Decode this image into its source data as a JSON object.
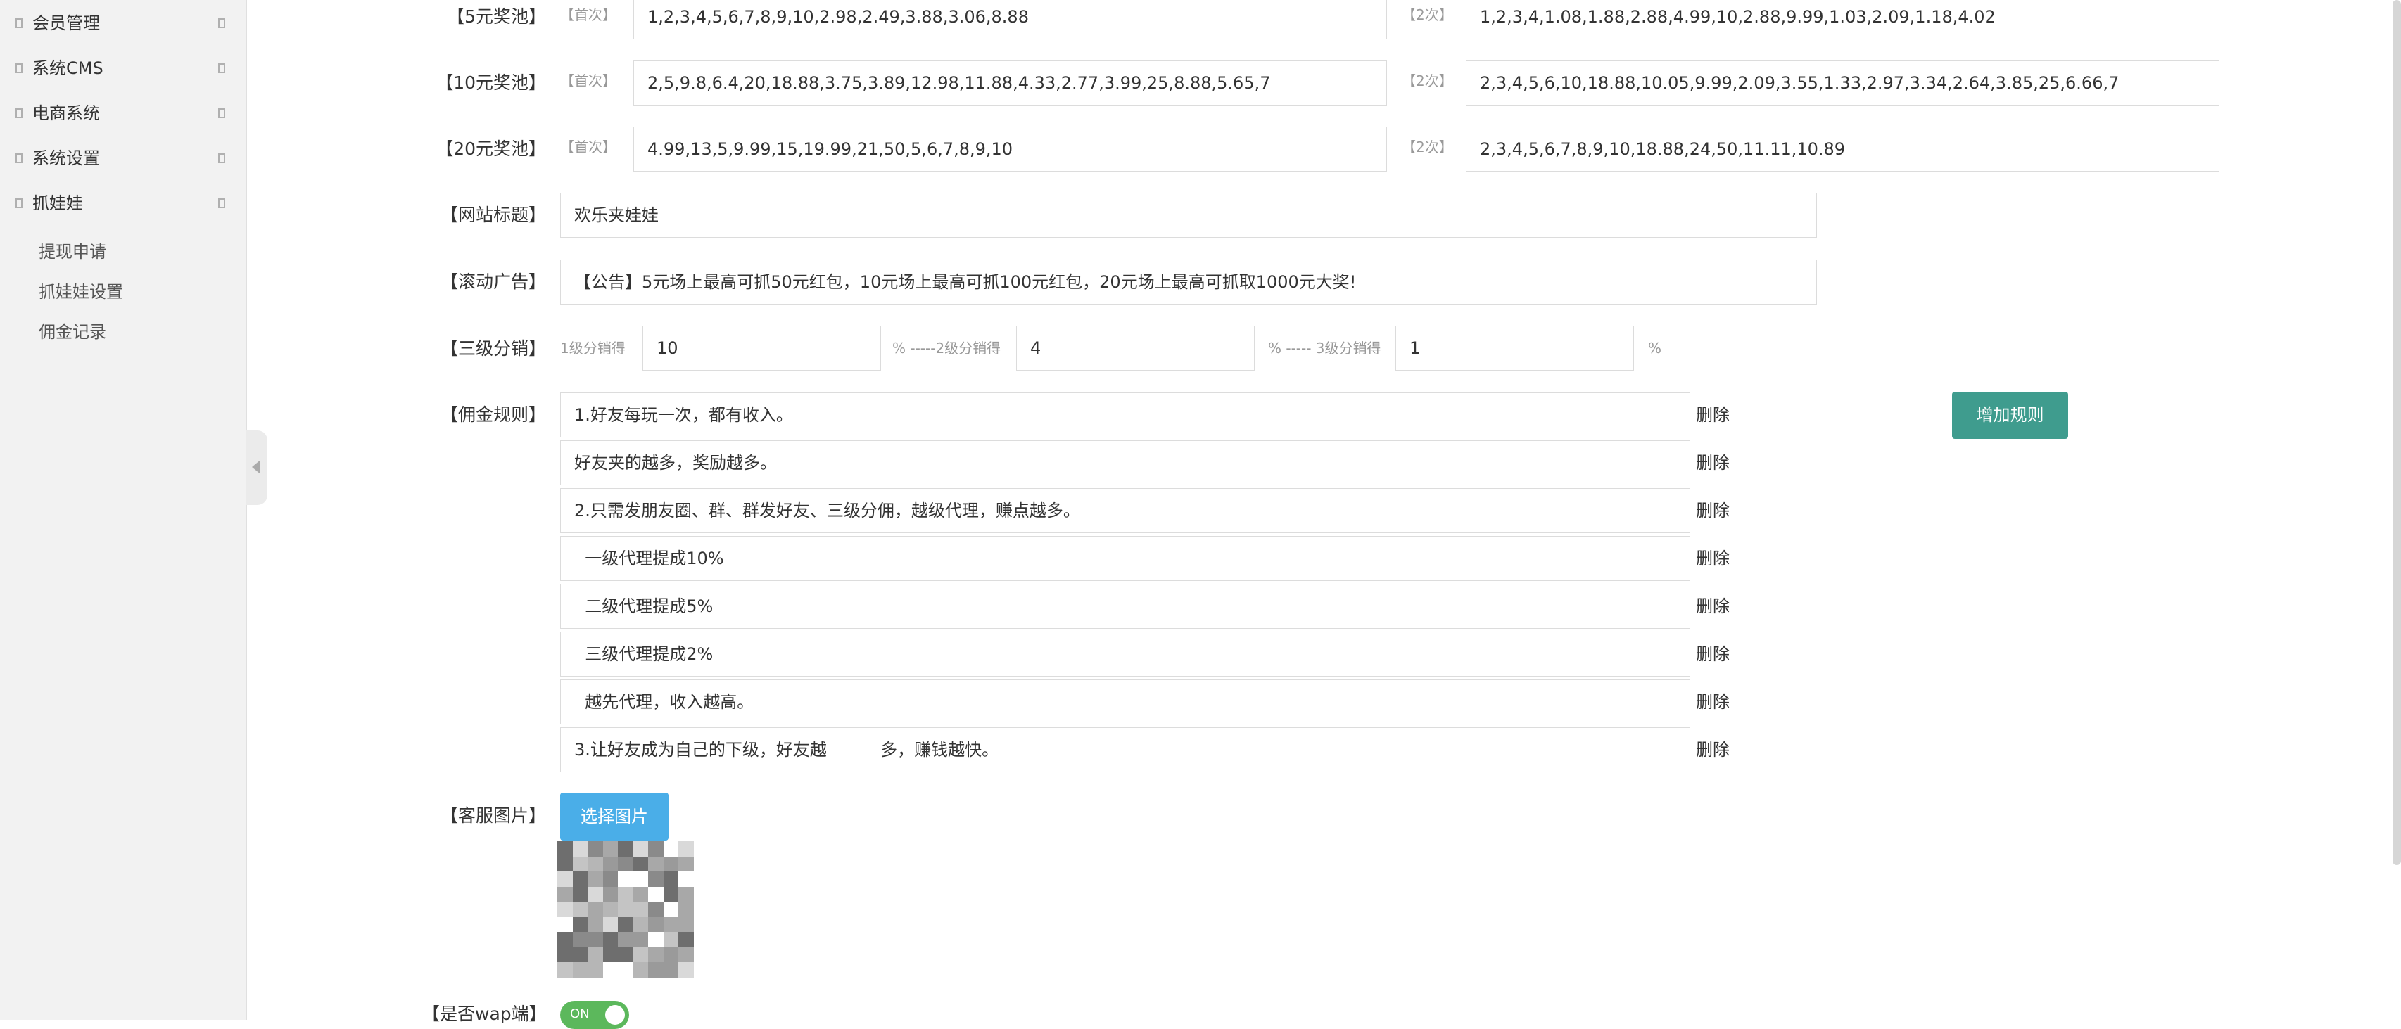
{
  "sidebar": {
    "menu": [
      {
        "label": "会员管理"
      },
      {
        "label": "系统CMS"
      },
      {
        "label": "电商系统"
      },
      {
        "label": "系统设置"
      },
      {
        "label": "抓娃娃"
      }
    ],
    "submenu": [
      {
        "label": "提现申请"
      },
      {
        "label": "抓娃娃设置"
      },
      {
        "label": "佣金记录"
      }
    ]
  },
  "form": {
    "pools": [
      {
        "label": "【5元奖池】",
        "first_tag": "【首次】",
        "first_value": "1,2,3,4,5,6,7,8,9,10,2.98,2.49,3.88,3.06,8.88",
        "second_tag": "【2次】",
        "second_value": "1,2,3,4,1.08,1.88,2.88,4.99,10,2.88,9.99,1.03,2.09,1.18,4.02"
      },
      {
        "label": "【10元奖池】",
        "first_tag": "【首次】",
        "first_value": "2,5,9.8,6.4,20,18.88,3.75,3.89,12.98,11.88,4.33,2.77,3.99,25,8.88,5.65,7",
        "second_tag": "【2次】",
        "second_value": "2,3,4,5,6,10,18.88,10.05,9.99,2.09,3.55,1.33,2.97,3.34,2.64,3.85,25,6.66,7"
      },
      {
        "label": "【20元奖池】",
        "first_tag": "【首次】",
        "first_value": "4.99,13,5,9.99,15,19.99,21,50,5,6,7,8,9,10",
        "second_tag": "【2次】",
        "second_value": "2,3,4,5,6,7,8,9,10,18.88,24,50,11.11,10.89"
      }
    ],
    "site_title": {
      "label": "【网站标题】",
      "value": "欢乐夹娃娃"
    },
    "scroll_ad": {
      "label": "【滚动广告】",
      "value": "【公告】5元场上最高可抓50元红包，10元场上最高可抓100元红包，20元场上最高可抓取1000元大奖!"
    },
    "distribution": {
      "label": "【三级分销】",
      "level1_label": "1级分销得",
      "level1_value": "10",
      "level2_label": "% -----2级分销得",
      "level2_value": "4",
      "level3_label": "% ----- 3级分销得",
      "level3_value": "1",
      "suffix": "%"
    },
    "commission": {
      "label": "【佣金规则】",
      "rules": [
        "1.好友每玩一次，都有收入。",
        "好友夹的越多，奖励越多。",
        "2.只需发朋友圈、群、群发好友、三级分佣，越级代理，赚点越多。",
        "  一级代理提成10%",
        "  二级代理提成5%",
        "  三级代理提成2%",
        "  越先代理，收入越高。",
        "3.让好友成为自己的下级，好友越          多，赚钱越快。"
      ],
      "delete_label": "删除",
      "add_button": "增加规则"
    },
    "service_image": {
      "label": "【客服图片】",
      "button": "选择图片"
    },
    "wap": {
      "label": "【是否wap端】",
      "toggle": "ON"
    }
  },
  "colors": {
    "add_button": "#3f9c8e",
    "pick_button": "#4aaee8",
    "toggle_on": "#5cb85c"
  }
}
